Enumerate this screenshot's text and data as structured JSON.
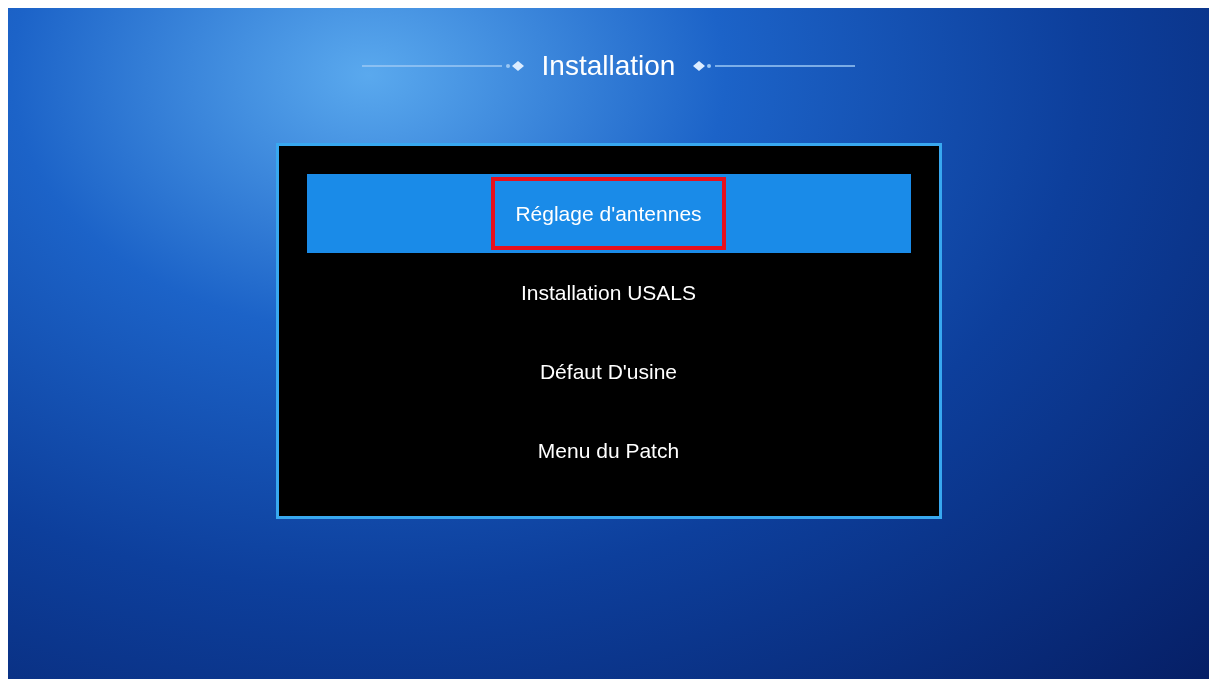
{
  "title": "Installation",
  "menu_items": [
    {
      "label": "Réglage d'antennes",
      "selected": true,
      "highlighted": true
    },
    {
      "label": "Installation USALS",
      "selected": false,
      "highlighted": false
    },
    {
      "label": "Défaut D'usine",
      "selected": false,
      "highlighted": false
    },
    {
      "label": "Menu du Patch",
      "selected": false,
      "highlighted": false
    }
  ]
}
